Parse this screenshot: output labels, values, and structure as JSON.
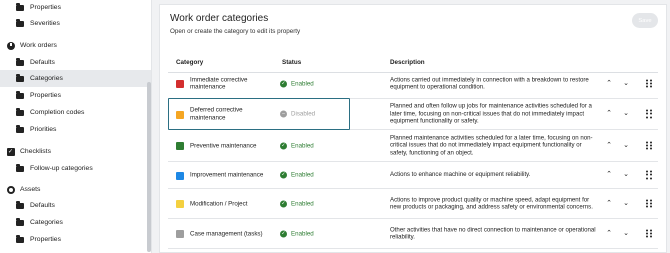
{
  "sidebar": {
    "items": [
      {
        "label": "Properties",
        "kind": "sub",
        "icon": "folder-icon"
      },
      {
        "label": "Severities",
        "kind": "sub",
        "icon": "folder-icon"
      },
      {
        "label": "Work orders",
        "kind": "top",
        "icon": "work-orders-icon"
      },
      {
        "label": "Defaults",
        "kind": "sub",
        "icon": "folder-icon"
      },
      {
        "label": "Categories",
        "kind": "sub",
        "icon": "folder-icon",
        "active": true
      },
      {
        "label": "Properties",
        "kind": "sub",
        "icon": "folder-icon"
      },
      {
        "label": "Completion codes",
        "kind": "sub",
        "icon": "folder-icon"
      },
      {
        "label": "Priorities",
        "kind": "sub",
        "icon": "folder-icon"
      },
      {
        "label": "Checklists",
        "kind": "top",
        "icon": "checklist-icon"
      },
      {
        "label": "Follow-up categories",
        "kind": "sub",
        "icon": "folder-icon"
      },
      {
        "label": "Assets",
        "kind": "top",
        "icon": "gear-icon"
      },
      {
        "label": "Defaults",
        "kind": "sub",
        "icon": "folder-icon"
      },
      {
        "label": "Categories",
        "kind": "sub",
        "icon": "folder-icon"
      },
      {
        "label": "Properties",
        "kind": "sub",
        "icon": "folder-icon"
      }
    ]
  },
  "main": {
    "title": "Work order categories",
    "subtitle": "Open or create the category to edit its property",
    "save_label": "Save",
    "columns": {
      "category": "Category",
      "status": "Status",
      "description": "Description"
    },
    "rows": [
      {
        "color": "#d32f2f",
        "category": "Immediate corrective maintenance",
        "status": "Enabled",
        "enabled": true,
        "description": "Actions carried out immediately in connection with a breakdown to restore equipment to operational condition."
      },
      {
        "color": "#f5a623",
        "category": "Deferred corrective maintenance",
        "status": "Disabled",
        "enabled": false,
        "description": "Planned and often follow up jobs for maintenance activities scheduled for a later time, focusing on non-critical issues that do not immediately impact equipment functionality or safety."
      },
      {
        "color": "#2e7d32",
        "category": "Preventive maintenance",
        "status": "Enabled",
        "enabled": true,
        "description": "Planned maintenance activities scheduled for a later time, focusing on non-critical issues that do not immediately impact equipment functionality or safety, functioning of an object."
      },
      {
        "color": "#1e88e5",
        "category": "Improvement maintenance",
        "status": "Enabled",
        "enabled": true,
        "description": "Actions to enhance machine or equipment reliability."
      },
      {
        "color": "#f4d03f",
        "category": "Modification / Project",
        "status": "Enabled",
        "enabled": true,
        "description": "Actions to improve product quality or machine speed, adapt equipment for new products or packaging, and address safety or environmental concerns."
      },
      {
        "color": "#9e9e9e",
        "category": "Case management (tasks)",
        "status": "Enabled",
        "enabled": true,
        "description": "Other activities that have no direct connection to maintenance or operational reliability."
      }
    ]
  },
  "colors": {
    "enabled": "#2e7d32",
    "disabled": "#9e9e9e",
    "highlight": "#2b6f83"
  }
}
